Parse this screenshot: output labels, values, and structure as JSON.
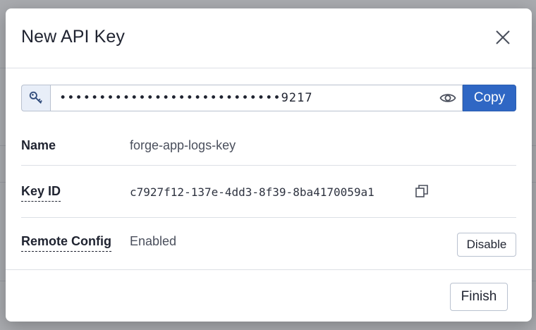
{
  "modal": {
    "title": "New API Key",
    "close_icon": "close-icon"
  },
  "api_key": {
    "prefix_icon": "key-icon",
    "masked_value": "••••••••••••••••••••••••••••9217",
    "reveal_icon": "eye-icon",
    "copy_label": "Copy"
  },
  "details": {
    "name": {
      "label": "Name",
      "value": "forge-app-logs-key"
    },
    "key_id": {
      "label": "Key ID",
      "value": "c7927f12-137e-4dd3-8f39-8ba4170059a1",
      "copy_icon": "copy-icon"
    },
    "remote_config": {
      "label": "Remote Config",
      "value": "Enabled",
      "action_label": "Disable"
    }
  },
  "footer": {
    "finish_label": "Finish"
  },
  "colors": {
    "primary": "#2f67c4",
    "prefix_bg": "#e8eef8"
  }
}
